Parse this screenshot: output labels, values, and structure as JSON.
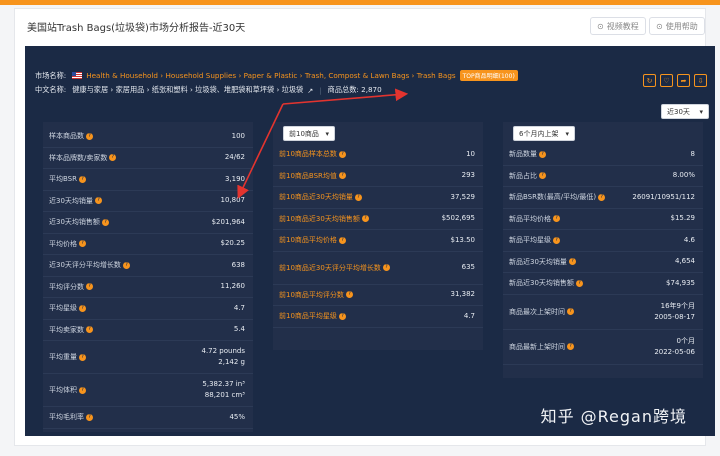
{
  "header": {
    "title": "美国站Trash Bags(垃圾袋)市场分析报告-近30天",
    "video_btn": "视频教程",
    "help_btn": "使用帮助"
  },
  "meta": {
    "market_label": "市场名称:",
    "market_path": "Health & Household › Household Supplies › Paper & Plastic › Trash, Compost & Lawn Bags › Trash Bags",
    "market_badge": "TOP商品明细(100)",
    "cn_label": "中文名称:",
    "cn_path": "健康与家居 › 家居用品 › 纸张和塑料 › 垃圾袋、堆肥袋和草坪袋 › 垃圾袋",
    "total": "商品总数: 2,870"
  },
  "period_select": "近30天",
  "col1": [
    {
      "k": "样本商品数",
      "v": "100"
    },
    {
      "k": "样本品牌数/卖家数",
      "v": "24/62"
    },
    {
      "k": "平均BSR",
      "v": "3,190"
    },
    {
      "k": "近30天均销量",
      "v": "10,807"
    },
    {
      "k": "近30天均销售额",
      "v": "$201,964"
    },
    {
      "k": "平均价格",
      "v": "$20.25"
    },
    {
      "k": "近30天评分平均增长数",
      "v": "638"
    },
    {
      "k": "平均评分数",
      "v": "11,260"
    },
    {
      "k": "平均星级",
      "v": "4.7"
    },
    {
      "k": "平均卖家数",
      "v": "5.4"
    },
    {
      "k": "平均重量",
      "v": "4.72 pounds",
      "v2": "2,142 g"
    },
    {
      "k": "平均体积",
      "v": "5,382.37 in³",
      "v2": "88,201 cm³"
    },
    {
      "k": "平均毛利率",
      "v": "45%"
    }
  ],
  "col2_select": "前10商品",
  "col2": [
    {
      "k": "前10商品样本总数",
      "v": "10"
    },
    {
      "k": "前10商品BSR均值",
      "v": "293"
    },
    {
      "k": "前10商品近30天均销量",
      "v": "37,529"
    },
    {
      "k": "前10商品近30天均销售额",
      "v": "$502,695"
    },
    {
      "k": "前10商品平均价格",
      "v": "$13.50"
    },
    {
      "k": "前10商品近30天评分平均增长数",
      "v": "635"
    },
    {
      "k": "前10商品平均评分数",
      "v": "31,382"
    },
    {
      "k": "前10商品平均星级",
      "v": "4.7"
    }
  ],
  "col3_select": "6个月内上架",
  "col3": [
    {
      "k": "新品数量",
      "v": "8"
    },
    {
      "k": "新品占比",
      "v": "8.00%"
    },
    {
      "k": "新品BSR数(最高/平均/最低)",
      "v": "26091/10951/112"
    },
    {
      "k": "新品平均价格",
      "v": "$15.29"
    },
    {
      "k": "新品平均星级",
      "v": "4.6"
    },
    {
      "k": "新品近30天均销量",
      "v": "4,654"
    },
    {
      "k": "新品近30天均销售额",
      "v": "$74,935"
    },
    {
      "k": "商品最次上架时间",
      "v": "16年9个月",
      "v2": "2005-08-17"
    },
    {
      "k": "商品最新上架时间",
      "v": "0个月",
      "v2": "2022-05-06"
    }
  ],
  "watermark": "知乎 @Regan跨境"
}
